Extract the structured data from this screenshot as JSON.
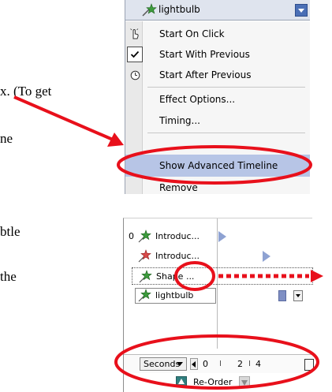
{
  "document": {
    "line1": "x. (To get",
    "line2": "ne",
    "line3": "btle",
    "line4": "the"
  },
  "menu": {
    "effect_name": "lightbulb",
    "items": [
      {
        "label": "Start On Click",
        "icon": "mouse-click-icon"
      },
      {
        "label": "Start With Previous",
        "icon": "check-icon"
      },
      {
        "label": "Start After Previous",
        "icon": "clock-icon"
      },
      {
        "label": "Effect Options..."
      },
      {
        "label": "Timing..."
      },
      {
        "label": "Show Advanced Timeline"
      },
      {
        "label": "Remove"
      }
    ]
  },
  "timeline": {
    "rows": [
      {
        "index": "0",
        "name": "Introduc...",
        "icon": "star-icon"
      },
      {
        "index": "",
        "name": "Introduc...",
        "icon": "star-icon"
      },
      {
        "index": "",
        "name": "Shape ...",
        "icon": "star-icon"
      },
      {
        "index": "",
        "name": "lightbulb",
        "icon": "star-icon"
      }
    ],
    "seconds_label": "Seconds",
    "ruler": [
      "0",
      "2",
      "4"
    ],
    "reorder_label": "Re-Order"
  },
  "colors": {
    "annotation_red": "#e8101b",
    "highlight": "#b7c5e6",
    "menu_header": "#dfe4ee",
    "star_green": "#3c9b3c",
    "star_red": "#d94a4a"
  }
}
